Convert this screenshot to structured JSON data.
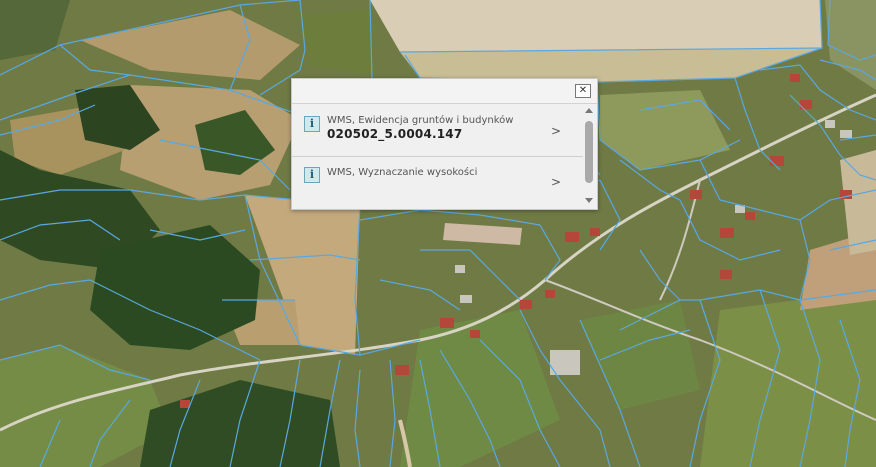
{
  "popup": {
    "close_symbol": "✕",
    "features": [
      {
        "source": "WMS, Ewidencja gruntów i budynków",
        "value": "020502_5.0004.147"
      },
      {
        "source": "WMS, Wyznaczanie wysokości",
        "value": ""
      }
    ]
  },
  "icons": {
    "info": "i",
    "chevron": ">"
  },
  "colors": {
    "parcel_lines": "#5aa8e0",
    "popup_background": "#f0f0f0",
    "info_icon": "#cfe9ee"
  }
}
